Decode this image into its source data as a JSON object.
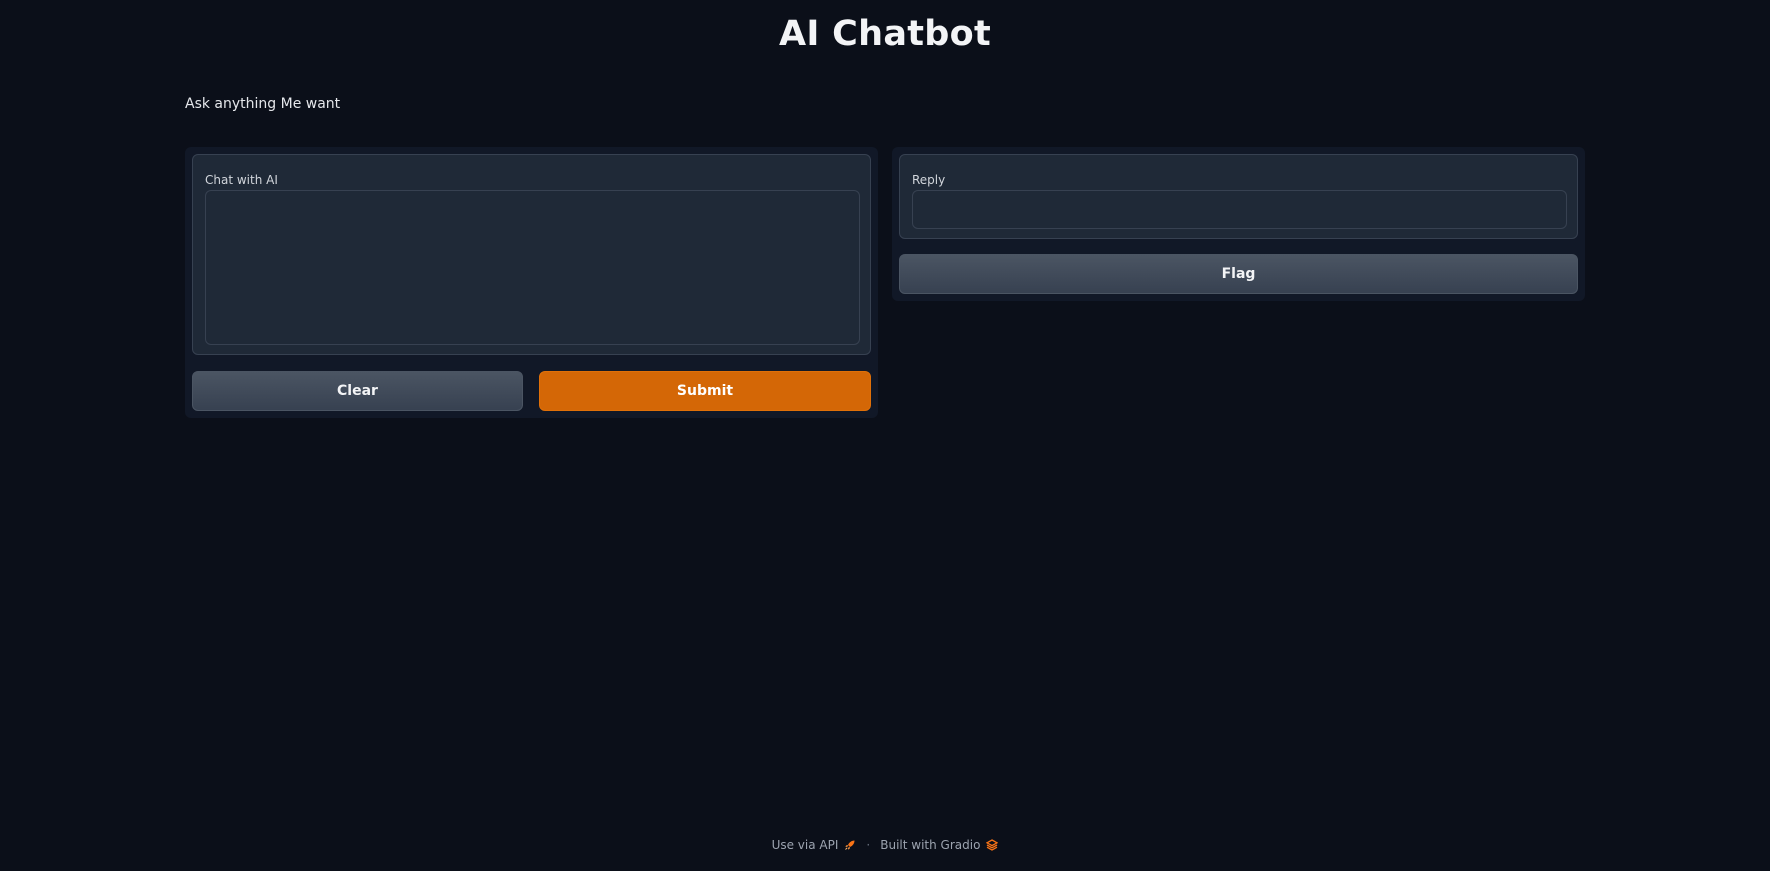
{
  "header": {
    "title": "AI Chatbot",
    "description": "Ask anything Me want"
  },
  "input_panel": {
    "textbox_label": "Chat with AI",
    "textbox_value": "",
    "clear_label": "Clear",
    "submit_label": "Submit"
  },
  "output_panel": {
    "textbox_label": "Reply",
    "textbox_value": "",
    "flag_label": "Flag"
  },
  "footer": {
    "api_label": "Use via API",
    "api_icon": "rocket-icon",
    "separator": "·",
    "built_label": "Built with Gradio",
    "gradio_icon": "gradio-logo-icon"
  },
  "colors": {
    "background": "#0b0f19",
    "panel": "#111827",
    "block": "#1f2937",
    "primary": "#d46706",
    "secondary": "#4b5563"
  }
}
